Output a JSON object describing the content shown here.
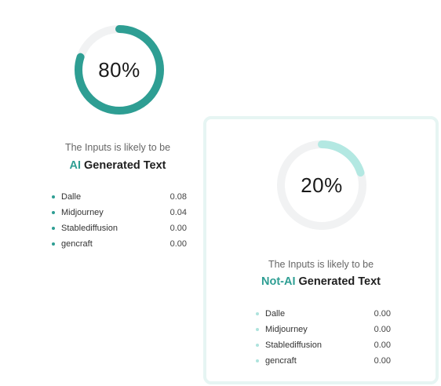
{
  "colors": {
    "accent": "#2e9e93",
    "accent_light": "#b3e8e2",
    "track": "#f1f2f3",
    "card_border": "#e6f5f3"
  },
  "ai_panel": {
    "percent": 80,
    "percent_label": "80%",
    "likely_text": "The Inputs is likely to be",
    "verdict_accent": "AI",
    "verdict_rest": " Generated Text",
    "models": [
      {
        "name": "Dalle",
        "score": "0.08"
      },
      {
        "name": "Midjourney",
        "score": "0.04"
      },
      {
        "name": "Stablediffusion",
        "score": "0.00"
      },
      {
        "name": "gencraft",
        "score": "0.00"
      }
    ]
  },
  "human_panel": {
    "percent": 20,
    "percent_label": "20%",
    "likely_text": "The Inputs is likely to be",
    "verdict_accent": "Not-AI",
    "verdict_rest": " Generated Text",
    "models": [
      {
        "name": "Dalle",
        "score": "0.00"
      },
      {
        "name": "Midjourney",
        "score": "0.00"
      },
      {
        "name": "Stablediffusion",
        "score": "0.00"
      },
      {
        "name": "gencraft",
        "score": "0.00"
      }
    ]
  }
}
